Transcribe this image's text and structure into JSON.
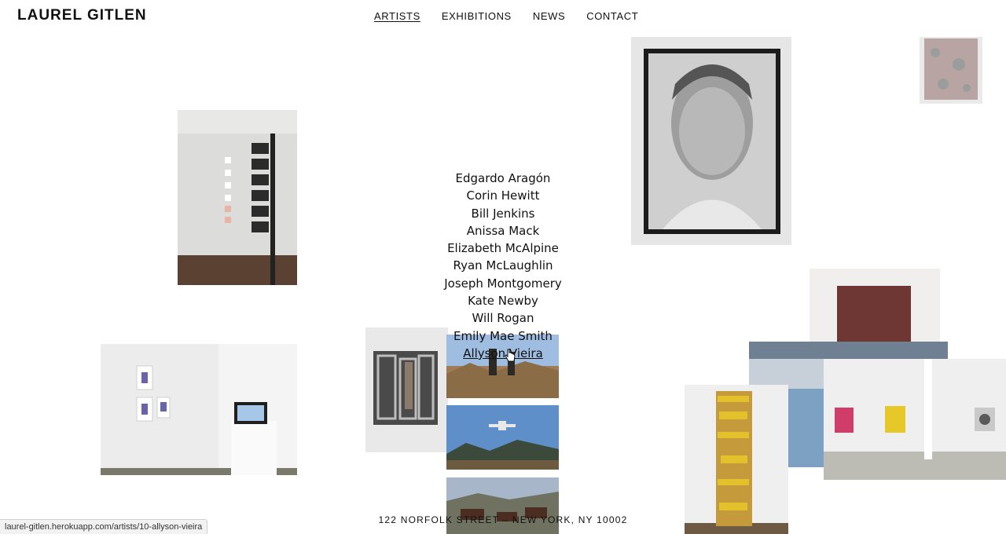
{
  "site": {
    "logo": "LAUREL GITLEN"
  },
  "nav": {
    "items": [
      {
        "label": "ARTISTS",
        "active": true
      },
      {
        "label": "EXHIBITIONS",
        "active": false
      },
      {
        "label": "NEWS",
        "active": false
      },
      {
        "label": "CONTACT",
        "active": false
      }
    ]
  },
  "artists": [
    "Edgardo Aragón",
    "Corin Hewitt",
    "Bill Jenkins",
    "Anissa Mack",
    "Elizabeth McAlpine",
    "Ryan McLaughlin",
    "Joseph Montgomery",
    "Kate Newby",
    "Will Rogan",
    "Emily Mae Smith",
    "Allyson Vieira"
  ],
  "hovered_artist": "Allyson Vieira",
  "footer": {
    "address": "122 NORFOLK STREET – NEW YORK, NY 10002"
  },
  "status_bar": {
    "url": "laurel-gitlen.herokuapp.com/artists/10-allyson-vieira"
  },
  "colors": {
    "text": "#111111",
    "background": "#ffffff",
    "status_bg": "#f2f2f2"
  }
}
